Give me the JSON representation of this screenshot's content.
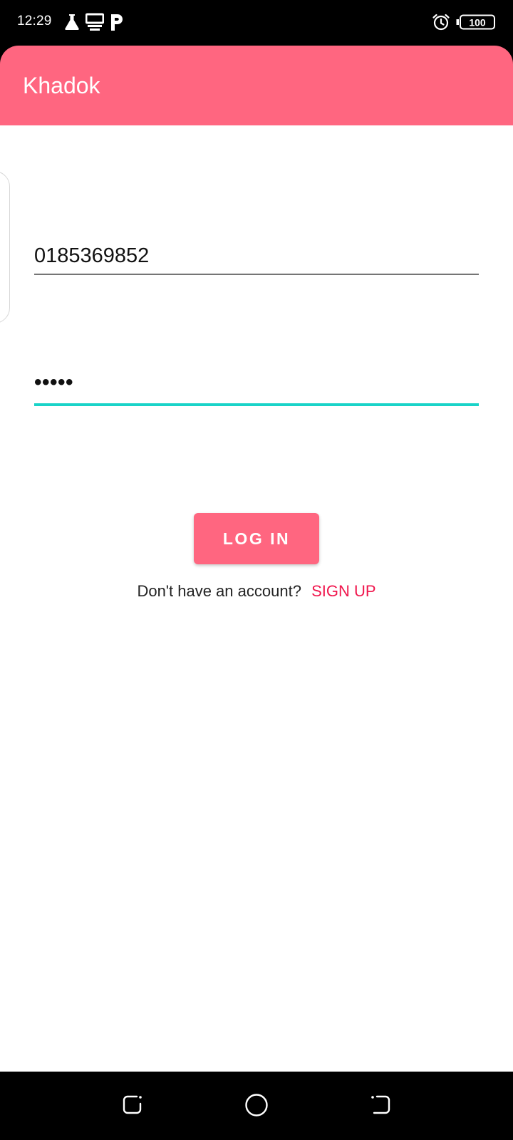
{
  "status_bar": {
    "time": "12:29",
    "battery": "100",
    "icons": [
      "flask-icon",
      "server-icon",
      "parking-icon",
      "alarm-icon",
      "battery-icon"
    ]
  },
  "app_bar": {
    "title": "Khadok",
    "color": "#ff6680"
  },
  "login_form": {
    "phone_value": "0185369852",
    "password_value": "•••••",
    "focus_color": "#19d3c8",
    "login_label": "LOG IN",
    "signup_prompt": "Don't have an account?",
    "signup_label": "SIGN UP",
    "link_color": "#f0164d"
  },
  "nav_bar": {
    "icons": [
      "recents-icon",
      "home-icon",
      "back-icon"
    ]
  }
}
